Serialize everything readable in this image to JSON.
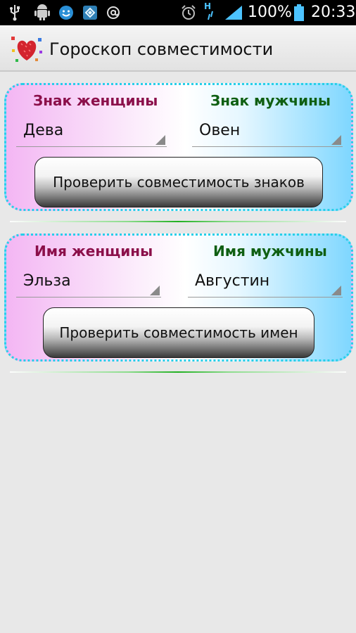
{
  "status_bar": {
    "battery_percent": "100%",
    "time": "20:33",
    "network": "H",
    "icons": [
      "usb-icon",
      "android-debug-icon",
      "smiley-icon",
      "app-icon",
      "at-sign-icon",
      "alarm-icon",
      "signal-icon",
      "signal-bars-icon",
      "battery-icon"
    ]
  },
  "app": {
    "title": "Гороскоп совместимости",
    "logo": "heart-logo-icon"
  },
  "signs_section": {
    "female_label": "Знак женщины",
    "male_label": "Знак мужчины",
    "female_value": "Дева",
    "male_value": "Овен",
    "button_label": "Проверить совместимость знаков"
  },
  "names_section": {
    "female_label": "Имя женщины",
    "male_label": "Имя мужчины",
    "female_value": "Эльза",
    "male_value": "Августин",
    "button_label": "Проверить совместимость имен"
  },
  "colors": {
    "female_label": "#8b0f4a",
    "male_label": "#0f5f12",
    "card_border": "#27cfe8",
    "divider": "#22b022"
  }
}
